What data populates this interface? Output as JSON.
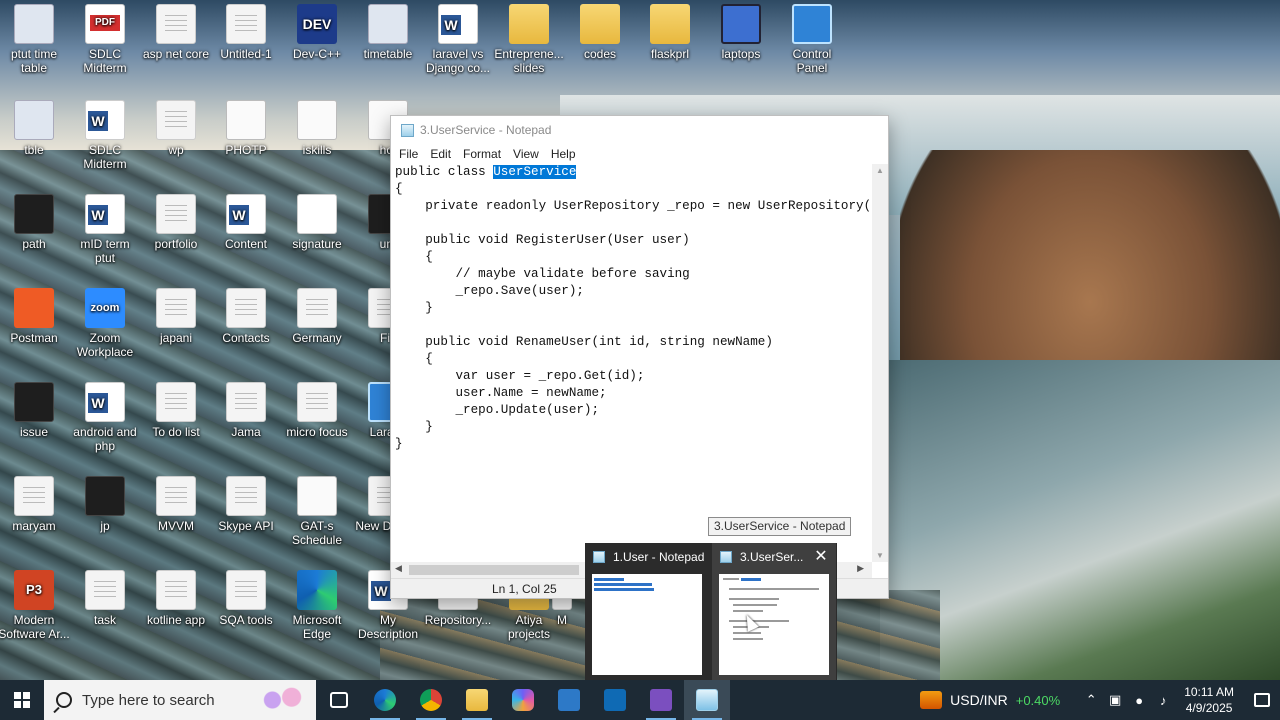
{
  "desktop": {
    "icons": [
      {
        "label": "ptut time table",
        "icon": "timetable-icon",
        "x": 0,
        "y": 2
      },
      {
        "label": "SDLC Midterm",
        "icon": "pdf-icon"
      },
      {
        "label": "asp net core",
        "icon": "document-icon"
      },
      {
        "label": "Untitled-1",
        "icon": "document-icon"
      },
      {
        "label": "Dev-C++",
        "icon": "devcpp-icon"
      },
      {
        "label": "timetable",
        "icon": "image-icon"
      },
      {
        "label": "laravel vs Django co...",
        "icon": "word-icon"
      },
      {
        "label": "Entreprene... slides",
        "icon": "folder-icon"
      },
      {
        "label": "codes",
        "icon": "folder-icon"
      },
      {
        "label": "flaskprl",
        "icon": "folder-icon"
      },
      {
        "label": "laptops",
        "icon": "laptop-icon"
      },
      {
        "label": "Control Panel",
        "icon": "control-panel-icon"
      },
      {
        "label": "tble",
        "icon": "image-icon"
      },
      {
        "label": "SDLC Midterm",
        "icon": "word-icon"
      },
      {
        "label": "wp",
        "icon": "document-icon"
      },
      {
        "label": "PHOTP",
        "icon": "document-icon"
      },
      {
        "label": "iskills",
        "icon": "image-icon"
      },
      {
        "label": "hot",
        "icon": "image-icon"
      },
      {
        "label": "path",
        "icon": "image-icon"
      },
      {
        "label": "mID term ptut",
        "icon": "word-icon"
      },
      {
        "label": "portfolio",
        "icon": "document-icon"
      },
      {
        "label": "Content",
        "icon": "word-icon"
      },
      {
        "label": "signature",
        "icon": "signature-icon"
      },
      {
        "label": "um",
        "icon": "image-icon"
      },
      {
        "label": "Postman",
        "icon": "postman-icon"
      },
      {
        "label": "Zoom Workplace",
        "icon": "zoom-icon"
      },
      {
        "label": "japani",
        "icon": "document-icon"
      },
      {
        "label": "Contacts",
        "icon": "document-icon"
      },
      {
        "label": "Germany",
        "icon": "document-icon"
      },
      {
        "label": "Fiv",
        "icon": "document-icon"
      },
      {
        "label": "issue",
        "icon": "image-icon"
      },
      {
        "label": "android and php",
        "icon": "word-icon"
      },
      {
        "label": "To do list",
        "icon": "document-icon"
      },
      {
        "label": "Jama",
        "icon": "document-icon"
      },
      {
        "label": "micro focus",
        "icon": "document-icon"
      },
      {
        "label": "Larave",
        "icon": "image-icon"
      },
      {
        "label": "maryam",
        "icon": "document-icon"
      },
      {
        "label": "jp",
        "icon": "image-icon"
      },
      {
        "label": "MVVM",
        "icon": "document-icon"
      },
      {
        "label": "Skype API",
        "icon": "document-icon"
      },
      {
        "label": "GAT-s Schedule",
        "icon": "image-icon"
      },
      {
        "label": "New Docum",
        "icon": "document-icon"
      },
      {
        "label": "Modern Software Ar...",
        "icon": "powerpoint-icon"
      },
      {
        "label": "task",
        "icon": "document-icon"
      },
      {
        "label": "kotline app",
        "icon": "document-icon"
      },
      {
        "label": "SQA tools",
        "icon": "document-icon"
      },
      {
        "label": "Microsoft Edge",
        "icon": "edge-icon"
      },
      {
        "label": "My Description",
        "icon": "word-icon"
      },
      {
        "label": "Repository...",
        "icon": "document-icon"
      },
      {
        "label": "Atiya projects",
        "icon": "folder-icon"
      },
      {
        "label": "M",
        "icon": "document-icon"
      }
    ]
  },
  "notepad": {
    "title": "3.UserService - Notepad",
    "menu": [
      "File",
      "Edit",
      "Format",
      "View",
      "Help"
    ],
    "code_lines": [
      {
        "pre": "public class ",
        "sel": "UserService",
        "post": ""
      },
      {
        "pre": "{",
        "sel": "",
        "post": ""
      },
      {
        "pre": "    private readonly UserRepository _repo = new UserRepository(",
        "sel": "",
        "post": ""
      },
      {
        "pre": "",
        "sel": "",
        "post": ""
      },
      {
        "pre": "    public void RegisterUser(User user)",
        "sel": "",
        "post": ""
      },
      {
        "pre": "    {",
        "sel": "",
        "post": ""
      },
      {
        "pre": "        // maybe validate before saving",
        "sel": "",
        "post": ""
      },
      {
        "pre": "        _repo.Save(user);",
        "sel": "",
        "post": ""
      },
      {
        "pre": "    }",
        "sel": "",
        "post": ""
      },
      {
        "pre": "",
        "sel": "",
        "post": ""
      },
      {
        "pre": "    public void RenameUser(int id, string newName)",
        "sel": "",
        "post": ""
      },
      {
        "pre": "    {",
        "sel": "",
        "post": ""
      },
      {
        "pre": "        var user = _repo.Get(id);",
        "sel": "",
        "post": ""
      },
      {
        "pre": "        user.Name = newName;",
        "sel": "",
        "post": ""
      },
      {
        "pre": "        _repo.Update(user);",
        "sel": "",
        "post": ""
      },
      {
        "pre": "    }",
        "sel": "",
        "post": ""
      },
      {
        "pre": "}",
        "sel": "",
        "post": ""
      }
    ],
    "status": "Ln 1, Col 25"
  },
  "preview": {
    "tooltip": "3.UserService - Notepad",
    "cards": [
      {
        "title": "1.User - Notepad",
        "active": false
      },
      {
        "title": "3.UserSer...",
        "active": true
      }
    ]
  },
  "taskbar": {
    "search_placeholder": "Type here to search",
    "apps": [
      "task-view-icon",
      "edge-icon",
      "chrome-icon",
      "file-explorer-icon",
      "copilot-icon",
      "store-icon",
      "outlook-icon",
      "visual-studio-icon",
      "notepad-icon"
    ],
    "stock_label": "USD/INR",
    "stock_change": "+0.40%",
    "time": "10:11 AM",
    "date": "4/9/2025"
  }
}
